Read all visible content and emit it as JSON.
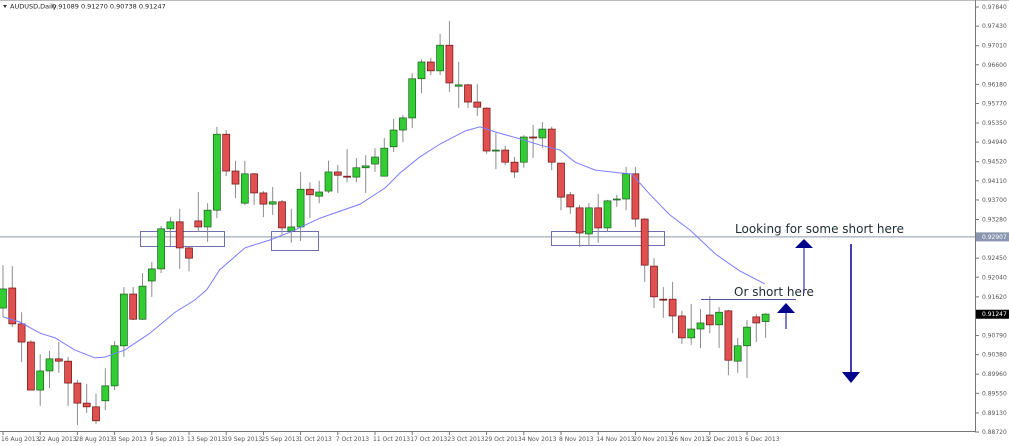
{
  "chart_data": {
    "type": "candlestick",
    "title": "AUDUSD,Daily",
    "title_ohlc": "0.91089 0.91270 0.90738 0.91247",
    "symbol": "AUDUSD",
    "timeframe": "Daily",
    "colors": {
      "up": "#32cd32",
      "down": "#e05050",
      "ma": "#7b7bff",
      "annotation": "#00008b",
      "hline": "#8a96a8",
      "box": "#6f6fb0"
    },
    "ylim": [
      0.8872,
      0.9784
    ],
    "y_ticks": [
      "0.97840",
      "0.97430",
      "0.97010",
      "0.96600",
      "0.96180",
      "0.95770",
      "0.95350",
      "0.94940",
      "0.94520",
      "0.94110",
      "0.93700",
      "0.93280",
      "0.92450",
      "0.92040",
      "0.91620",
      "0.90790",
      "0.90380",
      "0.89960",
      "0.89550",
      "0.89130",
      "0.88720"
    ],
    "y_tick_values": [
      0.9784,
      0.9743,
      0.9701,
      0.966,
      0.9618,
      0.9577,
      0.9535,
      0.9494,
      0.9452,
      0.9411,
      0.937,
      0.9328,
      0.9245,
      0.9204,
      0.9162,
      0.9079,
      0.9038,
      0.8996,
      0.8955,
      0.8913,
      0.8872
    ],
    "x_ticks": [
      {
        "label": "16 Aug 2013",
        "index": 0
      },
      {
        "label": "22 Aug 2013",
        "index": 4
      },
      {
        "label": "28 Aug 2013",
        "index": 8
      },
      {
        "label": "3 Sep 2013",
        "index": 12
      },
      {
        "label": "9 Sep 2013",
        "index": 16
      },
      {
        "label": "13 Sep 2013",
        "index": 20
      },
      {
        "label": "19 Sep 2013",
        "index": 24
      },
      {
        "label": "25 Sep 2013",
        "index": 28
      },
      {
        "label": "1 Oct 2013",
        "index": 32
      },
      {
        "label": "7 Oct 2013",
        "index": 36
      },
      {
        "label": "11 Oct 2013",
        "index": 40
      },
      {
        "label": "17 Oct 2013",
        "index": 44
      },
      {
        "label": "23 Oct 2013",
        "index": 48
      },
      {
        "label": "29 Oct 2013",
        "index": 52
      },
      {
        "label": "4 Nov 2013",
        "index": 56
      },
      {
        "label": "8 Nov 2013",
        "index": 60
      },
      {
        "label": "14 Nov 2013",
        "index": 64
      },
      {
        "label": "20 Nov 2013",
        "index": 68
      },
      {
        "label": "26 Nov 2013",
        "index": 72
      },
      {
        "label": "2 Dec 2013",
        "index": 76
      },
      {
        "label": "6 Dec 2013",
        "index": 80
      }
    ],
    "candles_ohlc": [
      [
        0.9138,
        0.923,
        0.9119,
        0.9179
      ],
      [
        0.9181,
        0.9228,
        0.9097,
        0.9104
      ],
      [
        0.9104,
        0.9129,
        0.9022,
        0.9065
      ],
      [
        0.9065,
        0.9069,
        0.8962,
        0.8962
      ],
      [
        0.8962,
        0.9039,
        0.8928,
        0.9003
      ],
      [
        0.9003,
        0.9046,
        0.8966,
        0.9029
      ],
      [
        0.9029,
        0.9065,
        0.8999,
        0.9024
      ],
      [
        0.9024,
        0.9033,
        0.8928,
        0.8977
      ],
      [
        0.8977,
        0.8984,
        0.8887,
        0.8934
      ],
      [
        0.8934,
        0.8975,
        0.8913,
        0.8926
      ],
      [
        0.8926,
        0.8954,
        0.8889,
        0.8896
      ],
      [
        0.8939,
        0.9009,
        0.8919,
        0.8971
      ],
      [
        0.8971,
        0.9067,
        0.8962,
        0.9057
      ],
      [
        0.9057,
        0.9183,
        0.9033,
        0.9168
      ],
      [
        0.9168,
        0.9183,
        0.9112,
        0.9114
      ],
      [
        0.9114,
        0.9213,
        0.9112,
        0.9185
      ],
      [
        0.9196,
        0.9237,
        0.9162,
        0.9222
      ],
      [
        0.9222,
        0.9314,
        0.9213,
        0.9308
      ],
      [
        0.9308,
        0.9333,
        0.9271,
        0.9323
      ],
      [
        0.9323,
        0.9351,
        0.9222,
        0.9267
      ],
      [
        0.9267,
        0.9271,
        0.9217,
        0.9245
      ],
      [
        0.9325,
        0.9387,
        0.9301,
        0.9312
      ],
      [
        0.9312,
        0.9363,
        0.928,
        0.9348
      ],
      [
        0.9348,
        0.9527,
        0.9331,
        0.9511
      ],
      [
        0.9511,
        0.952,
        0.9421,
        0.9432
      ],
      [
        0.9432,
        0.9454,
        0.9374,
        0.9404
      ],
      [
        0.9363,
        0.9454,
        0.9359,
        0.9426
      ],
      [
        0.9426,
        0.9428,
        0.9359,
        0.9385
      ],
      [
        0.9385,
        0.9389,
        0.9333,
        0.9361
      ],
      [
        0.9361,
        0.9398,
        0.9338,
        0.9366
      ],
      [
        0.9366,
        0.937,
        0.9295,
        0.931
      ],
      [
        0.9303,
        0.9351,
        0.9278,
        0.9312
      ],
      [
        0.9312,
        0.943,
        0.9282,
        0.9393
      ],
      [
        0.9393,
        0.9408,
        0.9331,
        0.9381
      ],
      [
        0.9378,
        0.9411,
        0.9363,
        0.9387
      ],
      [
        0.9389,
        0.9454,
        0.9385,
        0.943
      ],
      [
        0.943,
        0.9445,
        0.9385,
        0.9423
      ],
      [
        0.9421,
        0.9479,
        0.9408,
        0.9419
      ],
      [
        0.9419,
        0.946,
        0.9408,
        0.9439
      ],
      [
        0.9439,
        0.9466,
        0.9385,
        0.9443
      ],
      [
        0.9447,
        0.9481,
        0.943,
        0.9462
      ],
      [
        0.9421,
        0.9503,
        0.9421,
        0.9481
      ],
      [
        0.9484,
        0.9544,
        0.9473,
        0.952
      ],
      [
        0.952,
        0.9552,
        0.9494,
        0.9546
      ],
      [
        0.9546,
        0.9642,
        0.9524,
        0.963
      ],
      [
        0.963,
        0.9672,
        0.9599,
        0.9666
      ],
      [
        0.9666,
        0.9675,
        0.9638,
        0.9647
      ],
      [
        0.9647,
        0.9726,
        0.9638,
        0.9702
      ],
      [
        0.9702,
        0.9754,
        0.9602,
        0.9621
      ],
      [
        0.9614,
        0.9666,
        0.9567,
        0.9617
      ],
      [
        0.9617,
        0.9619,
        0.9567,
        0.958
      ],
      [
        0.958,
        0.9619,
        0.955,
        0.9569
      ],
      [
        0.9567,
        0.9569,
        0.9469,
        0.9475
      ],
      [
        0.9475,
        0.9514,
        0.9436,
        0.9477
      ],
      [
        0.9477,
        0.9486,
        0.9445,
        0.9451
      ],
      [
        0.9451,
        0.9462,
        0.9417,
        0.943
      ],
      [
        0.9451,
        0.9509,
        0.9439,
        0.9505
      ],
      [
        0.9505,
        0.9531,
        0.946,
        0.9503
      ],
      [
        0.9503,
        0.9537,
        0.9481,
        0.9522
      ],
      [
        0.9522,
        0.9527,
        0.9434,
        0.9451
      ],
      [
        0.9449,
        0.9449,
        0.9348,
        0.9376
      ],
      [
        0.9381,
        0.9387,
        0.934,
        0.9355
      ],
      [
        0.9353,
        0.9359,
        0.9269,
        0.9299
      ],
      [
        0.9297,
        0.9363,
        0.9273,
        0.9353
      ],
      [
        0.9353,
        0.9383,
        0.9278,
        0.931
      ],
      [
        0.931,
        0.937,
        0.9301,
        0.9368
      ],
      [
        0.9372,
        0.9381,
        0.9355,
        0.9372
      ],
      [
        0.9372,
        0.9441,
        0.9348,
        0.9426
      ],
      [
        0.9426,
        0.9441,
        0.9312,
        0.9329
      ],
      [
        0.9329,
        0.9331,
        0.9194,
        0.923
      ],
      [
        0.9228,
        0.9245,
        0.9138,
        0.9162
      ],
      [
        0.9157,
        0.9183,
        0.9117,
        0.9155
      ],
      [
        0.9157,
        0.9194,
        0.9084,
        0.9121
      ],
      [
        0.9121,
        0.9132,
        0.9061,
        0.9074
      ],
      [
        0.9074,
        0.9147,
        0.9059,
        0.9093
      ],
      [
        0.9093,
        0.9136,
        0.9052,
        0.9106
      ],
      [
        0.9123,
        0.9164,
        0.9084,
        0.9102
      ],
      [
        0.9102,
        0.914,
        0.9052,
        0.9129
      ],
      [
        0.9132,
        0.9134,
        0.8994,
        0.9026
      ],
      [
        0.9024,
        0.9074,
        0.8999,
        0.9057
      ],
      [
        0.9057,
        0.9112,
        0.8988,
        0.9097
      ],
      [
        0.9119,
        0.9125,
        0.9065,
        0.9106
      ],
      [
        0.9109,
        0.9127,
        0.9074,
        0.9125
      ]
    ],
    "moving_average": [
      [
        0,
        0.9119
      ],
      [
        1.8,
        0.9108
      ],
      [
        4,
        0.9084
      ],
      [
        5.6,
        0.9074
      ],
      [
        7.7,
        0.9048
      ],
      [
        9.9,
        0.9031
      ],
      [
        11,
        0.9033
      ],
      [
        13.1,
        0.9048
      ],
      [
        15.8,
        0.9084
      ],
      [
        18.5,
        0.9129
      ],
      [
        20.6,
        0.9155
      ],
      [
        21.9,
        0.9177
      ],
      [
        23.3,
        0.922
      ],
      [
        26,
        0.9267
      ],
      [
        28.7,
        0.9284
      ],
      [
        30.9,
        0.9301
      ],
      [
        34.1,
        0.9331
      ],
      [
        38.4,
        0.9361
      ],
      [
        41.1,
        0.9396
      ],
      [
        42.7,
        0.9428
      ],
      [
        44.8,
        0.9462
      ],
      [
        47,
        0.949
      ],
      [
        49.7,
        0.9518
      ],
      [
        51.3,
        0.9527
      ],
      [
        52.9,
        0.9516
      ],
      [
        55.6,
        0.9501
      ],
      [
        57.7,
        0.9488
      ],
      [
        59.9,
        0.9477
      ],
      [
        61.5,
        0.9451
      ],
      [
        63.7,
        0.9434
      ],
      [
        66.3,
        0.9428
      ],
      [
        67.6,
        0.9426
      ],
      [
        69.6,
        0.9381
      ],
      [
        71.7,
        0.9338
      ],
      [
        73.9,
        0.9305
      ],
      [
        76.6,
        0.9254
      ],
      [
        79.2,
        0.9218
      ],
      [
        81.9,
        0.919
      ]
    ],
    "horizontal_line": {
      "value": 0.92907,
      "label": "0.92907"
    },
    "current_price": {
      "value": 0.91247,
      "label": "0.91247"
    },
    "annotations": {
      "looking_text": "Looking for some short here",
      "or_short_text": "Or short here"
    }
  }
}
